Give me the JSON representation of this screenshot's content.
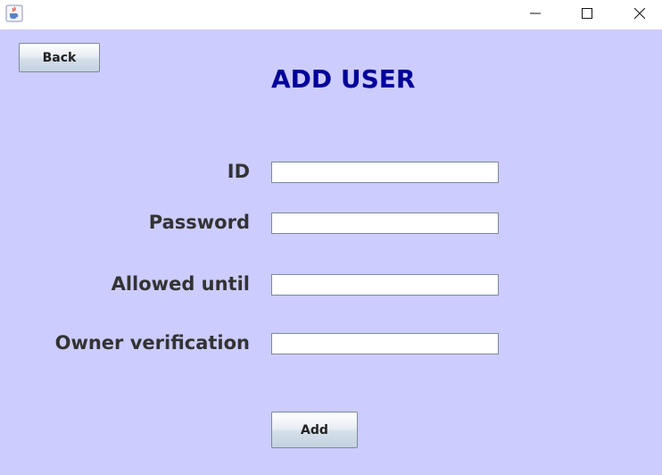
{
  "window": {
    "minimize_icon": "minimize-icon",
    "maximize_icon": "maximize-icon",
    "close_icon": "close-icon",
    "app_icon": "java-coffee-cup-icon"
  },
  "back_button": {
    "label": "Back"
  },
  "heading": "ADD USER",
  "form": {
    "id_label": "ID",
    "id_value": "",
    "password_label": "Password",
    "password_value": "",
    "allowed_until_label": "Allowed until",
    "allowed_until_value": "",
    "owner_verification_label": "Owner verification",
    "owner_verification_value": ""
  },
  "add_button": {
    "label": "Add"
  },
  "colors": {
    "background": "#ccccff",
    "heading": "#00009a",
    "label": "#333333"
  }
}
